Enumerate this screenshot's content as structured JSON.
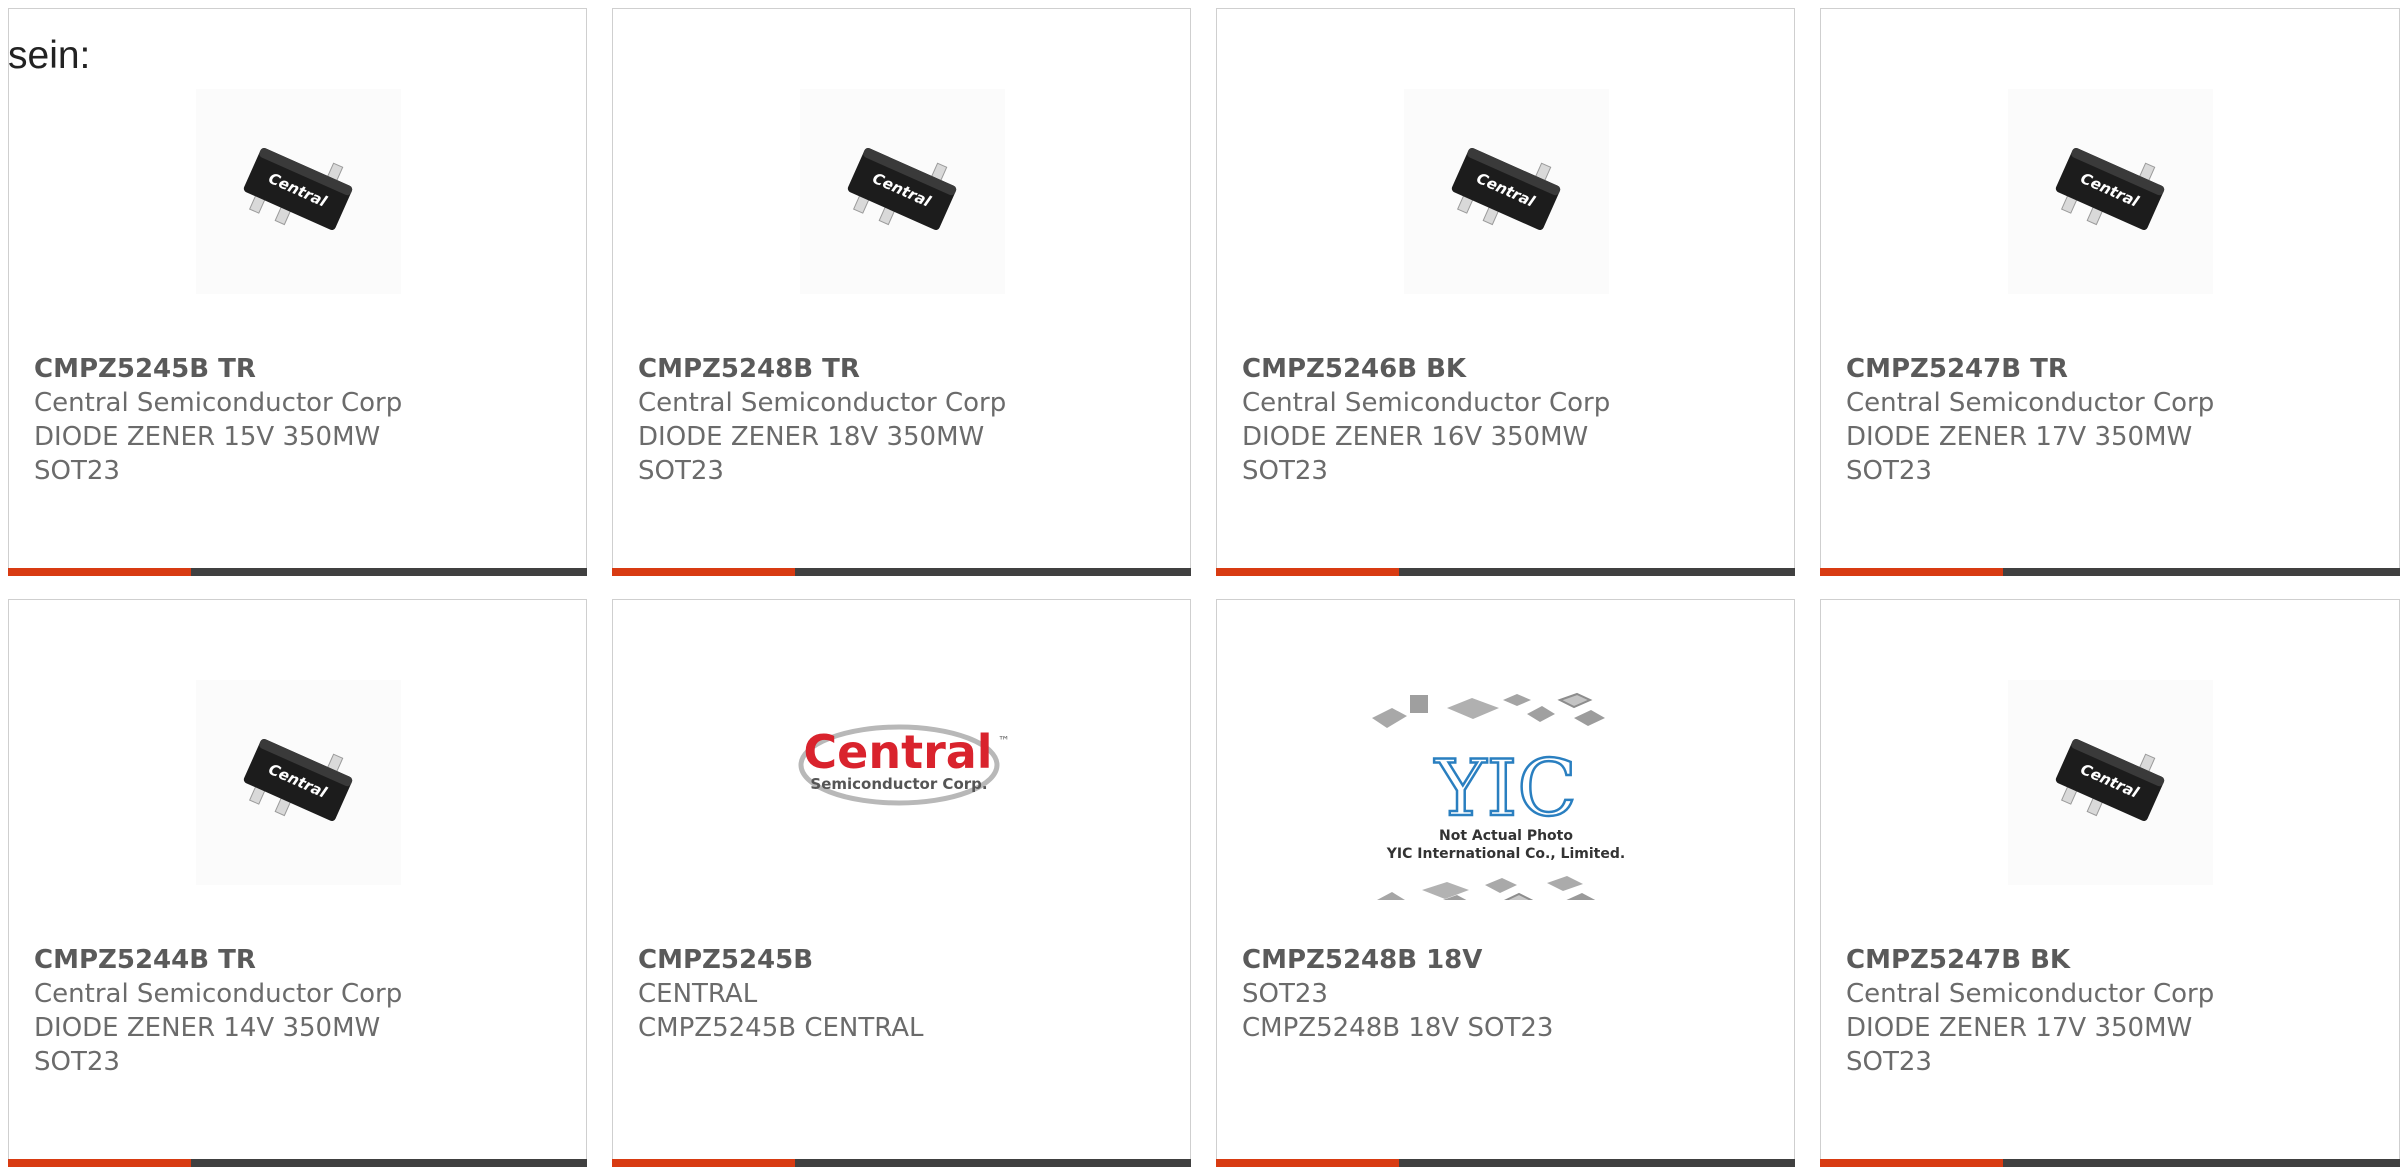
{
  "intro_text": "sein:",
  "colors": {
    "accent": "#d83b12",
    "bar": "#404040",
    "text": "#6b6b6b",
    "card_border": "#cfcfcf"
  },
  "cards": [
    {
      "part": "CMPZ5245B TR",
      "line1": "Central Semiconductor Corp",
      "line2": "DIODE ZENER 15V 350MW",
      "line3": "SOT23",
      "image": "sot23-chip-photo"
    },
    {
      "part": "CMPZ5248B TR",
      "line1": "Central Semiconductor Corp",
      "line2": "DIODE ZENER 18V 350MW",
      "line3": "SOT23",
      "image": "sot23-chip-photo"
    },
    {
      "part": "CMPZ5246B BK",
      "line1": "Central Semiconductor Corp",
      "line2": "DIODE ZENER 16V 350MW",
      "line3": "SOT23",
      "image": "sot23-chip-photo"
    },
    {
      "part": "CMPZ5247B TR",
      "line1": "Central Semiconductor Corp",
      "line2": "DIODE ZENER 17V 350MW",
      "line3": "SOT23",
      "image": "sot23-chip-photo"
    },
    {
      "part": "CMPZ5244B TR",
      "line1": "Central Semiconductor Corp",
      "line2": "DIODE ZENER 14V 350MW",
      "line3": "SOT23",
      "image": "sot23-chip-photo"
    },
    {
      "part": "CMPZ5245B",
      "line1": "CENTRAL",
      "line2": "CMPZ5245B CENTRAL",
      "line3": "",
      "image": "central-logo"
    },
    {
      "part": "CMPZ5248B 18V",
      "line1": "SOT23",
      "line2": "CMPZ5248B 18V SOT23",
      "line3": "",
      "image": "placeholder-photo"
    },
    {
      "part": "CMPZ5247B BK",
      "line1": "Central Semiconductor Corp",
      "line2": "DIODE ZENER 17V 350MW",
      "line3": "SOT23",
      "image": "sot23-chip-photo"
    }
  ],
  "chip_marking": "Central",
  "logo": {
    "word": "Central",
    "sub": "Semiconductor Corp.",
    "tm": "™"
  },
  "placeholder": {
    "brand": "YIC",
    "note1": "Not Actual Photo",
    "note2": "YIC International Co., Limited."
  }
}
